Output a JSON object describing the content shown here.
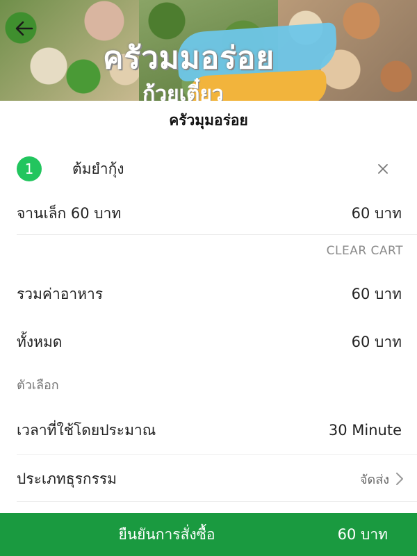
{
  "header": {
    "logo_line1": "ครัวมมอร่อย",
    "logo_line2": "ก้วยเตี๋ยว"
  },
  "store": {
    "name": "ครัวมุมอร่อย"
  },
  "cart": {
    "items": [
      {
        "qty": "1",
        "name": "ต้มยำกุ้ง",
        "option": "จานเล็ก 60 บาท",
        "price": "60 บาท"
      }
    ],
    "clear_label": "CLEAR CART"
  },
  "summary": {
    "subtotal_label": "รวมค่าอาหาร",
    "subtotal_value": "60 บาท",
    "total_label": "ทั้งหมด",
    "total_value": "60 บาท"
  },
  "options": {
    "section_label": "ตัวเลือก",
    "time_label": "เวลาที่ใช้โดยประมาณ",
    "time_value": "30 Minute",
    "business_label": "ประเภทธุรกรรม",
    "business_value": "จัดส่ง"
  },
  "confirm": {
    "label": "ยืนยันการสั่งซื้อ",
    "total": "60 บาท"
  },
  "colors": {
    "accent": "#1a9a40",
    "badge": "#22c55e"
  },
  "icons": [
    "back-arrow-icon",
    "close-icon",
    "chevron-right-icon"
  ]
}
